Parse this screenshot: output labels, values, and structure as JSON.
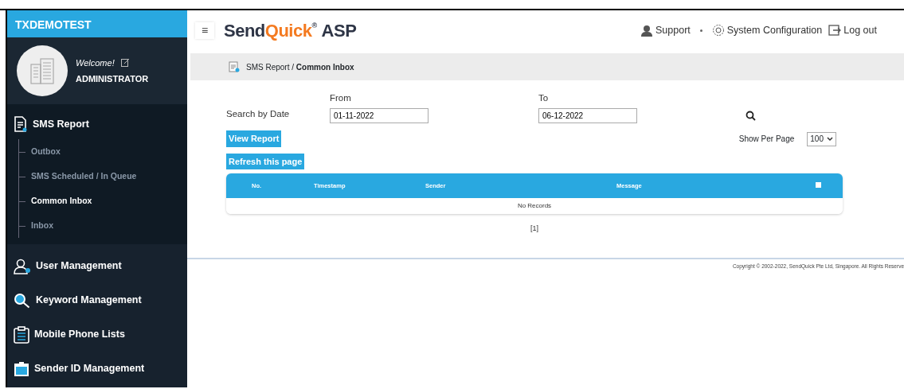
{
  "sidebar": {
    "title": "TXDEMOTEST",
    "welcome": "Welcome!",
    "user": "ADMINISTRATOR",
    "items": [
      {
        "label": "SMS Report",
        "children": [
          {
            "label": "Outbox",
            "selected": false
          },
          {
            "label": "SMS Scheduled / In Queue",
            "selected": false
          },
          {
            "label": "Common Inbox",
            "selected": true
          },
          {
            "label": "Inbox",
            "selected": false
          }
        ]
      },
      {
        "label": "User Management"
      },
      {
        "label": "Keyword Management"
      },
      {
        "label": "Mobile Phone Lists"
      },
      {
        "label": "Sender ID Management"
      }
    ]
  },
  "header": {
    "menu": "≡",
    "brand": {
      "first": "Send",
      "accent": "Quick",
      "mark": "®",
      "last": "ASP"
    },
    "links": [
      {
        "label": "Support",
        "dropdown": true
      },
      {
        "label": "System Configuration",
        "dropdown": false
      },
      {
        "label": "Log out",
        "dropdown": false
      }
    ]
  },
  "breadcrumb": {
    "parent": "SMS Report /",
    "current": "Common Inbox"
  },
  "search": {
    "label": "Search by Date",
    "from_label": "From",
    "from": "01-11-2022",
    "to_label": "To",
    "to": "06-12-2022"
  },
  "buttons": [
    "View Report",
    "Refresh this page"
  ],
  "per_page": {
    "label": "Show Per Page",
    "value": "100"
  },
  "table": {
    "columns": [
      "No.",
      "Timestamp",
      "Sender",
      "Message"
    ],
    "select_all": false,
    "empty": "No Records"
  },
  "pager": "[1]",
  "footer": "Copyright © 2002-2022, SendQuick Pte Ltd, Singapore. All Rights Reserve"
}
